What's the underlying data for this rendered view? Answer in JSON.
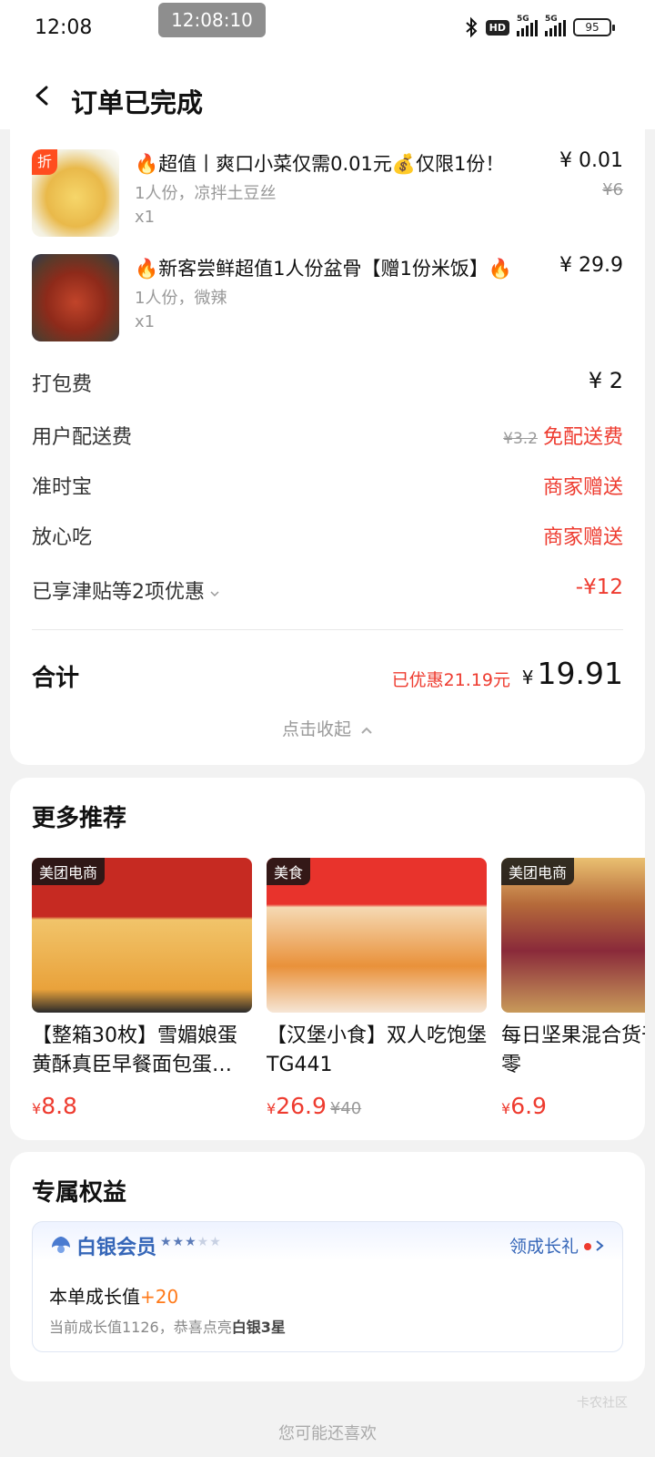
{
  "status_bar": {
    "time": "12:08",
    "overlay_time": "12:08:10",
    "hd_label": "HD",
    "network_label": "5G",
    "battery": "95"
  },
  "header": {
    "title": "订单已完成"
  },
  "order": {
    "items": [
      {
        "tag": "折",
        "name": "🔥超值丨爽口小菜仅需0.01元💰仅限1份！",
        "spec": "1人份，凉拌土豆丝",
        "qty": "x1",
        "price": "¥ 0.01",
        "orig_price": "¥6"
      },
      {
        "name": "🔥新客尝鲜超值1人份盆骨【赠1份米饭】🔥",
        "spec": "1人份，微辣",
        "qty": "x1",
        "price": "¥ 29.9"
      }
    ],
    "fees": {
      "packing_label": "打包费",
      "packing_value": "¥ 2",
      "delivery_label": "用户配送费",
      "delivery_orig": "¥3.2",
      "delivery_value": "免配送费",
      "ontime_label": "准时宝",
      "ontime_value": "商家赠送",
      "safe_label": "放心吃",
      "safe_value": "商家赠送",
      "discount_label": "已享津贴等2项优惠",
      "discount_value": "-¥12"
    },
    "total_label": "合计",
    "total_discount": "已优惠21.19元",
    "total_currency": "¥",
    "total_amount": "19.91",
    "collapse_label": "点击收起"
  },
  "recommend": {
    "title": "更多推荐",
    "items": [
      {
        "tag": "美团电商",
        "name": "【整箱30枚】雪媚娘蛋黄酥真臣早餐面包蛋…",
        "currency": "¥",
        "price": "8.8",
        "orig_price": ""
      },
      {
        "tag": "美食",
        "name": "【汉堡小食】双人吃饱堡TG441",
        "currency": "¥",
        "price": "26.9",
        "orig_price": "¥40"
      },
      {
        "tag": "美团电商",
        "name": "每日坚果混合货干果休闲零",
        "currency": "¥",
        "price": "6.9",
        "orig_price": ""
      }
    ]
  },
  "rights": {
    "title": "专属权益",
    "member_title": "白银会员",
    "stars_on": "★★★",
    "stars_off": "★★",
    "link_label": "领成长礼",
    "growth_label": "本单成长值",
    "growth_value": "+20",
    "note_prefix": "当前成长值1126，恭喜点亮",
    "note_bold": "白银3星"
  },
  "bottom_hint": "您可能还喜欢",
  "watermark": "卡农社区"
}
